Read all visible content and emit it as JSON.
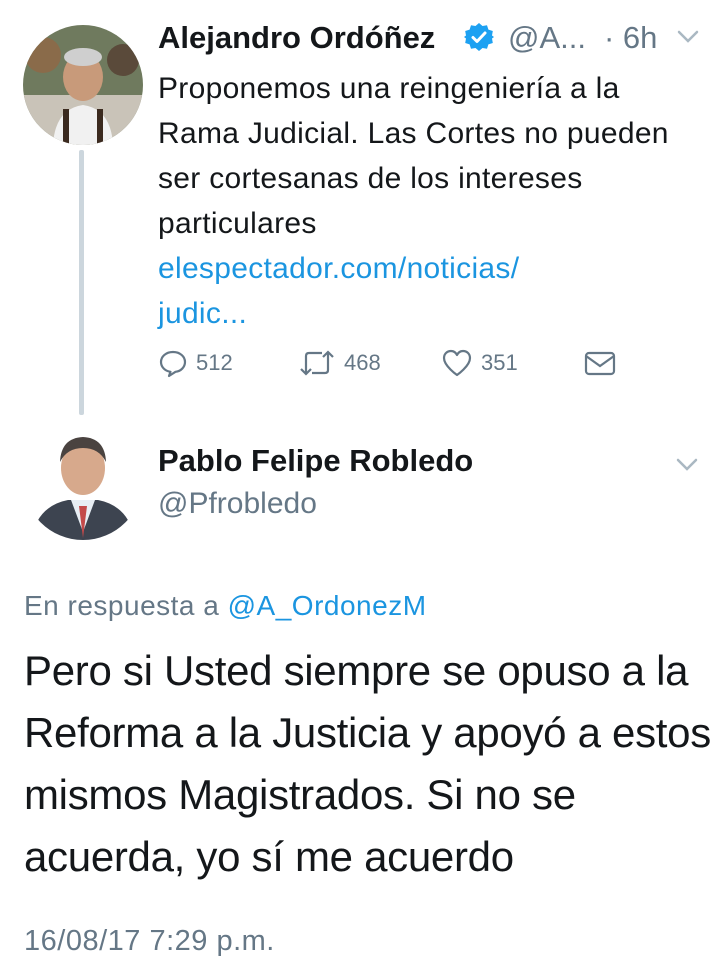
{
  "tweet1": {
    "author_name": "Alejandro Ordóñez",
    "author_handle": "@A...",
    "time": "· 6h",
    "text": "Proponemos una reingeniería a la Rama Judicial. Las Cortes no pueden ser cortesanas de los intereses particulares",
    "link_line1": "elespectador.com/noticias/",
    "link_line2": "judic...",
    "replies": "512",
    "retweets": "468",
    "likes": "351"
  },
  "tweet2": {
    "author_name": "Pablo Felipe Robledo",
    "author_handle": "@Pfrobledo",
    "reply_prefix": "En respuesta a ",
    "reply_mention": "@A_OrdonezM",
    "body": "Pero si Usted siempre se opuso a la Reforma a la Justicia y apoyó a estos mismos Magistrados. Si no se acuerda, yo sí me acuerdo",
    "timestamp": "16/08/17 7:29 p.m."
  },
  "colors": {
    "link": "#1b95e0",
    "secondary_text": "#657786",
    "verified_badge": "#1da1f2",
    "thread_line": "#ccd6dd"
  },
  "icons": [
    "reply-icon",
    "retweet-icon",
    "like-icon",
    "direct-message-icon",
    "chevron-down-icon",
    "verified-badge-icon"
  ]
}
